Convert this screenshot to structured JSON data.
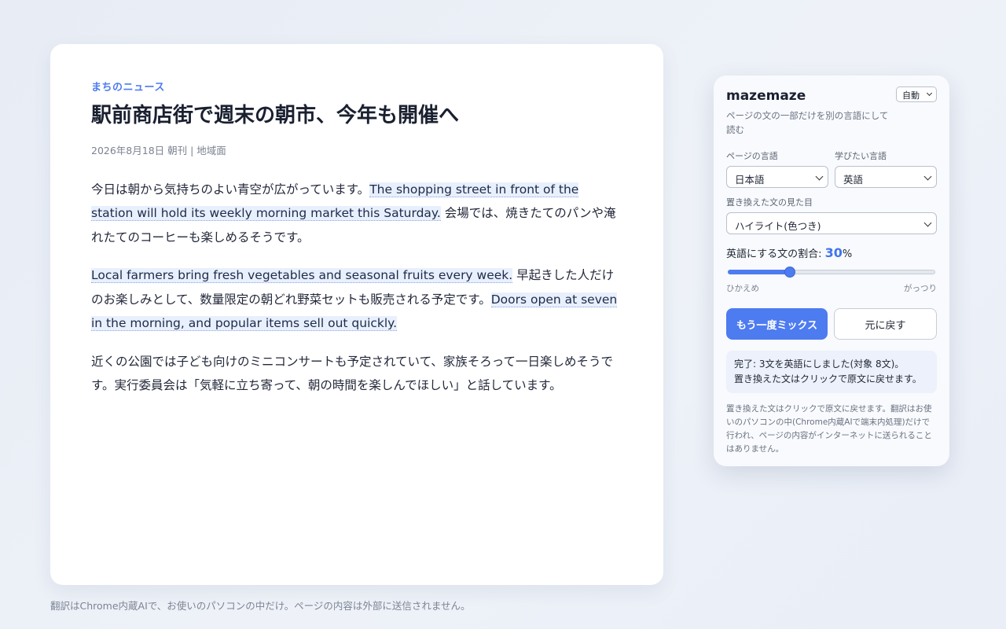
{
  "article": {
    "kicker": "まちのニュース",
    "headline": "駅前商店街で週末の朝市、今年も開催へ",
    "meta": "2026年8月18日 朝刊 | 地域面",
    "paragraphs": [
      [
        {
          "text": "今日は朝から気持ちのよい青空が広がっています。",
          "mixed": false
        },
        {
          "text": "The shopping street in front of the station will hold its weekly morning market this Saturday.",
          "mixed": true
        },
        {
          "text": " 会場では、焼きたてのパンや淹れたてのコーヒーも楽しめるそうです。",
          "mixed": false
        }
      ],
      [
        {
          "text": "Local farmers bring fresh vegetables and seasonal fruits every week.",
          "mixed": true
        },
        {
          "text": " 早起きした人だけのお楽しみとして、数量限定の朝どれ野菜セットも販売される予定です。",
          "mixed": false
        },
        {
          "text": "Doors open at seven in the morning, and popular items sell out quickly.",
          "mixed": true
        }
      ],
      [
        {
          "text": "近くの公園では子ども向けのミニコンサートも予定されていて、家族そろって一日楽しめそうです。実行委員会は「気軽に立ち寄って、朝の時間を楽しんでほしい」と話しています。",
          "mixed": false
        }
      ]
    ]
  },
  "footer_note": "翻訳はChrome内蔵AIで、お使いのパソコンの中だけ。ページの内容は外部に送信されません。",
  "panel": {
    "title": "mazemaze",
    "mode_select": "自動",
    "subtitle": "ページの文の一部だけを別の言語にして読む",
    "page_lang_label": "ページの言語",
    "page_lang_value": "日本語",
    "target_lang_label": "学びたい言語",
    "target_lang_value": "英語",
    "style_label": "置き換えた文の見た目",
    "style_value": "ハイライト(色つき)",
    "ratio_label": "英語にする文の割合:",
    "ratio_value": "30",
    "ratio_unit": "%",
    "ratio_fraction": 0.3,
    "scale_min": "ひかえめ",
    "scale_max": "がっつり",
    "remix_button": "もう一度ミックス",
    "restore_button": "元に戻す",
    "status_line1": "完了: 3文を英語にしました(対象 8文)。",
    "status_line2": "置き換えた文はクリックで原文に戻せます。",
    "note": "置き換えた文はクリックで原文に戻せます。翻訳はお使いのパソコンの中(Chrome内蔵AIで端末内処理)だけで行われ、ページの内容がインターネットに送られることはありません。"
  },
  "colors": {
    "accent": "#4d7bf0",
    "highlight_bg": "#e8f0fd"
  }
}
